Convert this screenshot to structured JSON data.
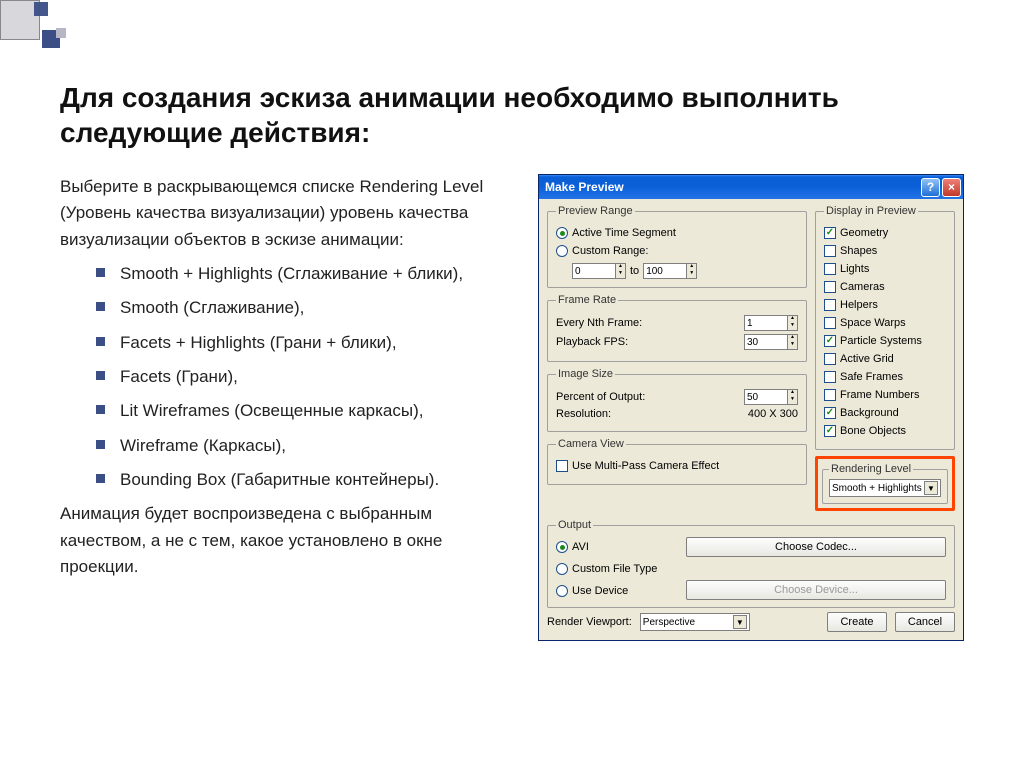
{
  "slide": {
    "title": "Для создания эскиза анимации необходимо выполнить следующие действия:",
    "intro": "Выберите в раскрывающемся списке Rendering Level (Уровень качества визуализации) уровень качества визуализации объектов в эскизе анимации:",
    "bullets": [
      "Smooth + Highlights (Сглаживание + блики),",
      "Smooth (Сглаживание),",
      " Facets + Highlights (Грани + блики),",
      "Facets (Грани),",
      "Lit Wireframes (Освещенные каркасы),",
      "Wireframe (Каркасы),",
      "Bounding Box (Габаритные контейнеры)."
    ],
    "outro": "Анимация будет воспроизведена с выбранным качеством, а не с тем, какое установлено в окне проекции."
  },
  "dialog": {
    "title": "Make Preview",
    "help": "?",
    "close": "×",
    "previewRange": {
      "legend": "Preview Range",
      "activeLabel": "Active Time Segment",
      "customLabel": "Custom Range:",
      "from": "0",
      "to_label": "to",
      "to": "100"
    },
    "frameRate": {
      "legend": "Frame Rate",
      "nthLabel": "Every Nth Frame:",
      "nthValue": "1",
      "fpsLabel": "Playback FPS:",
      "fpsValue": "30"
    },
    "imageSize": {
      "legend": "Image Size",
      "percentLabel": "Percent of Output:",
      "percentValue": "50",
      "resLabel": "Resolution:",
      "resValue": "400  X  300"
    },
    "cameraView": {
      "legend": "Camera View",
      "multiPassLabel": "Use Multi-Pass Camera Effect"
    },
    "displayInPreview": {
      "legend": "Display in Preview",
      "items": [
        {
          "label": "Geometry",
          "checked": true
        },
        {
          "label": "Shapes",
          "checked": false
        },
        {
          "label": "Lights",
          "checked": false
        },
        {
          "label": "Cameras",
          "checked": false
        },
        {
          "label": "Helpers",
          "checked": false
        },
        {
          "label": "Space Warps",
          "checked": false
        },
        {
          "label": "Particle Systems",
          "checked": true
        },
        {
          "label": "Active Grid",
          "checked": false
        },
        {
          "label": "Safe Frames",
          "checked": false
        },
        {
          "label": "Frame Numbers",
          "checked": false
        },
        {
          "label": "Background",
          "checked": true
        },
        {
          "label": "Bone Objects",
          "checked": true
        }
      ]
    },
    "renderingLevel": {
      "legend": "Rendering Level",
      "value": "Smooth + Highlights"
    },
    "output": {
      "legend": "Output",
      "aviLabel": "AVI",
      "customLabel": "Custom File Type",
      "deviceLabel": "Use Device",
      "codecBtn": "Choose Codec...",
      "deviceBtn": "Choose Device..."
    },
    "footer": {
      "viewportLabel": "Render Viewport:",
      "viewportValue": "Perspective",
      "createBtn": "Create",
      "cancelBtn": "Cancel"
    }
  }
}
